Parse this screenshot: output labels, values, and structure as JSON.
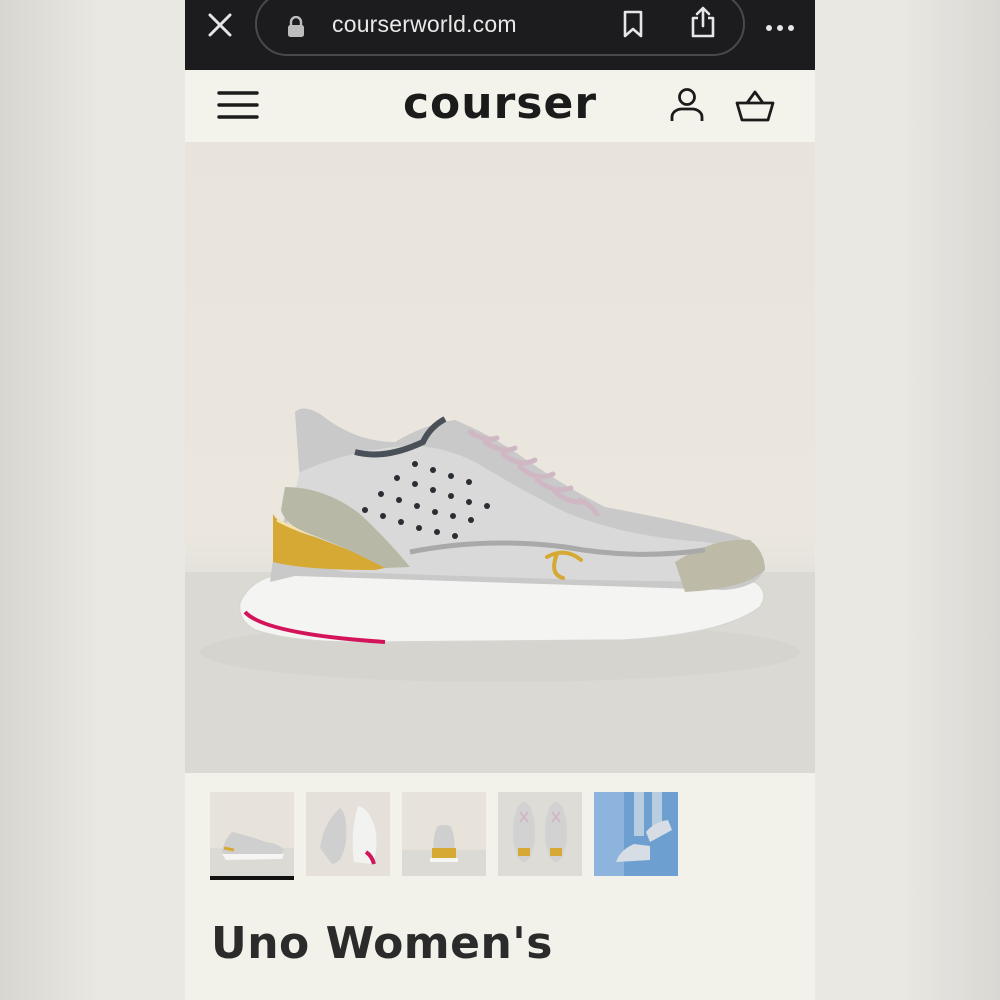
{
  "browser": {
    "url": "courserworld.com",
    "icons": [
      "close-icon",
      "lock-icon",
      "bookmark-icon",
      "share-icon",
      "more-icon"
    ]
  },
  "header": {
    "logo_text": "courser",
    "icons": [
      "menu-icon",
      "account-icon",
      "cart-icon"
    ]
  },
  "product": {
    "title": "Uno Women's",
    "thumbnails": [
      {
        "view": "side"
      },
      {
        "view": "sole"
      },
      {
        "view": "back"
      },
      {
        "view": "top"
      },
      {
        "view": "worn"
      }
    ],
    "selected_thumbnail": 1
  },
  "colors": {
    "browser_bar": "#1c1c1e",
    "page_bg": "#f2f1ea",
    "heel_accent": "#d4145a",
    "gold_accent": "#d6a935"
  }
}
